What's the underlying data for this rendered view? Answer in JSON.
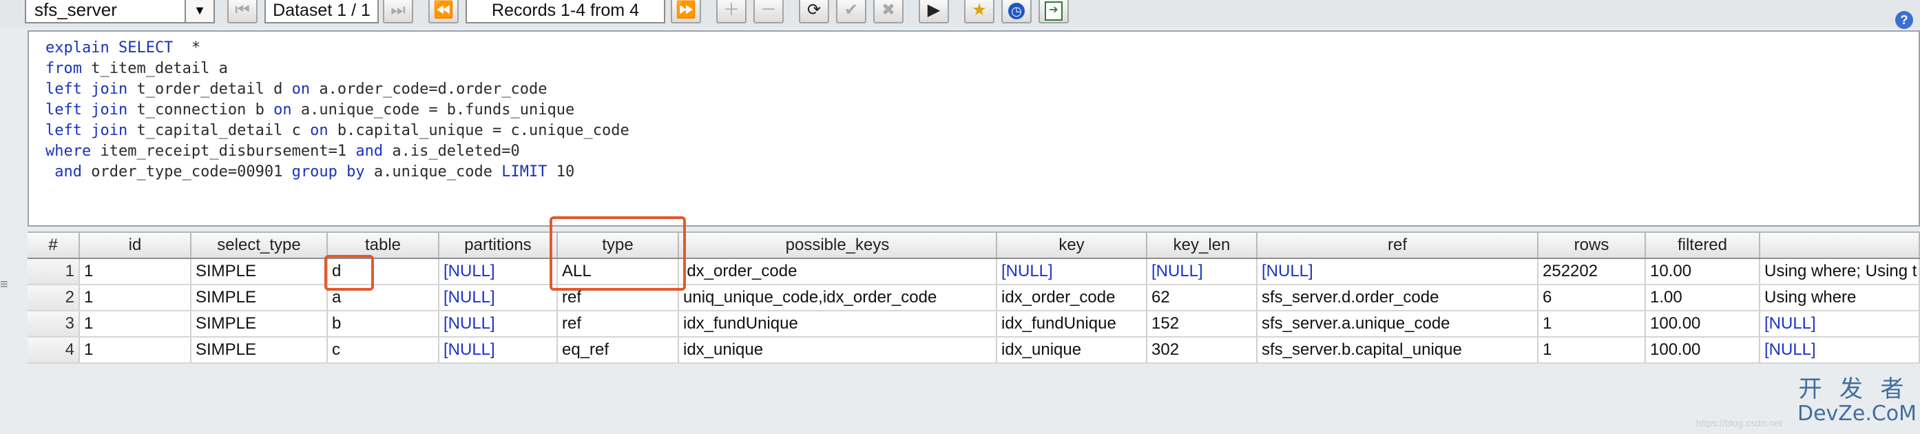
{
  "toolbar": {
    "connection_select": "sfs_server",
    "dataset_label": "Dataset 1 / 1",
    "records_label": "Records 1-4 from 4",
    "icons": [
      "first-page-icon",
      "last-page-icon",
      "prev-icon",
      "next-icon",
      "add-icon",
      "remove-icon",
      "refresh-icon",
      "apply-icon",
      "cancel-icon",
      "run-icon",
      "favorite-icon",
      "history-icon",
      "export-icon",
      "help-icon"
    ]
  },
  "editor": {
    "lines": [
      [
        {
          "t": "explain SELECT",
          "kw": true
        },
        {
          "t": "  *",
          "kw": false
        }
      ],
      [
        {
          "t": "from",
          "kw": true
        },
        {
          "t": " t_item_detail a",
          "kw": false
        }
      ],
      [
        {
          "t": "left join",
          "kw": true
        },
        {
          "t": " t_order_detail d ",
          "kw": false
        },
        {
          "t": "on",
          "kw": true
        },
        {
          "t": " a.order_code=d.order_code",
          "kw": false
        }
      ],
      [
        {
          "t": "left join",
          "kw": true
        },
        {
          "t": " t_connection b ",
          "kw": false
        },
        {
          "t": "on",
          "kw": true
        },
        {
          "t": " a.unique_code = b.funds_unique",
          "kw": false
        }
      ],
      [
        {
          "t": "left join",
          "kw": true
        },
        {
          "t": " t_capital_detail c ",
          "kw": false
        },
        {
          "t": "on",
          "kw": true
        },
        {
          "t": " b.capital_unique = c.unique_code",
          "kw": false
        }
      ],
      [
        {
          "t": "where",
          "kw": true
        },
        {
          "t": " item_receipt_disbursement=1 ",
          "kw": false
        },
        {
          "t": "and",
          "kw": true
        },
        {
          "t": " a.is_deleted=0",
          "kw": false
        }
      ],
      [
        {
          "t": " and",
          "kw": true
        },
        {
          "t": " order_type_code=00901 ",
          "kw": false
        },
        {
          "t": "group by",
          "kw": true
        },
        {
          "t": " a.unique_code ",
          "kw": false
        },
        {
          "t": "LIMIT",
          "kw": true
        },
        {
          "t": " 10",
          "kw": false
        }
      ]
    ]
  },
  "grid": {
    "columns": [
      "#",
      "id",
      "select_type",
      "table",
      "partitions",
      "type",
      "possible_keys",
      "key",
      "key_len",
      "ref",
      "rows",
      "filtered",
      ""
    ],
    "rows": [
      [
        "1",
        "1",
        "SIMPLE",
        "d",
        "[NULL]",
        "ALL",
        "idx_order_code",
        "[NULL]",
        "[NULL]",
        "[NULL]",
        "252202",
        "10.00",
        "Using where; Using t"
      ],
      [
        "2",
        "1",
        "SIMPLE",
        "a",
        "[NULL]",
        "ref",
        "uniq_unique_code,idx_order_code",
        "idx_order_code",
        "62",
        "sfs_server.d.order_code",
        "6",
        "1.00",
        "Using where"
      ],
      [
        "3",
        "1",
        "SIMPLE",
        "b",
        "[NULL]",
        "ref",
        "idx_fundUnique",
        "idx_fundUnique",
        "152",
        "sfs_server.a.unique_code",
        "1",
        "100.00",
        "[NULL]"
      ],
      [
        "4",
        "1",
        "SIMPLE",
        "c",
        "[NULL]",
        "eq_ref",
        "idx_unique",
        "idx_unique",
        "302",
        "sfs_server.b.capital_unique",
        "1",
        "100.00",
        "[NULL]"
      ]
    ],
    "highlight_color": "#e15a2f",
    "null_color": "#1d33c9"
  },
  "watermark": {
    "top": "开 发 者",
    "bottom": "DevZe.CoM"
  }
}
